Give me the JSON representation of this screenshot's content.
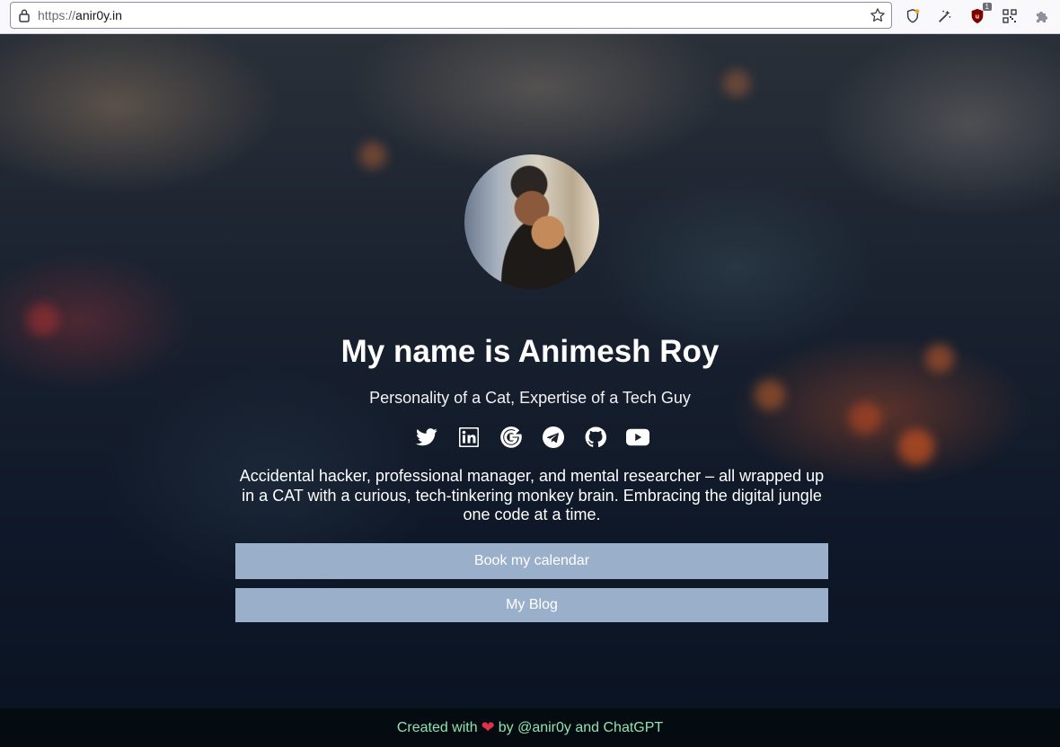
{
  "browser": {
    "url_protocol": "https://",
    "url_host": "anir0y.in",
    "extension_badge": "1"
  },
  "profile": {
    "name_heading": "My name is Animesh Roy",
    "tagline": "Personality of a Cat, Expertise of a Tech Guy",
    "bio": "Accidental hacker, professional manager, and mental researcher – all wrapped up in a CAT with a curious, tech-tinkering monkey brain. Embracing the digital jungle one code at a time."
  },
  "social_icons": [
    "twitter-icon",
    "linkedin-icon",
    "google-icon",
    "telegram-icon",
    "github-icon",
    "youtube-icon"
  ],
  "buttons": {
    "calendar": "Book my calendar",
    "blog": "My Blog"
  },
  "footer": {
    "prefix": "Created with",
    "suffix": "by @anir0y and ChatGPT"
  },
  "colors": {
    "button_bg": "#9aafc9",
    "footer_text": "#8fe3b0",
    "heart": "#e0314b"
  }
}
